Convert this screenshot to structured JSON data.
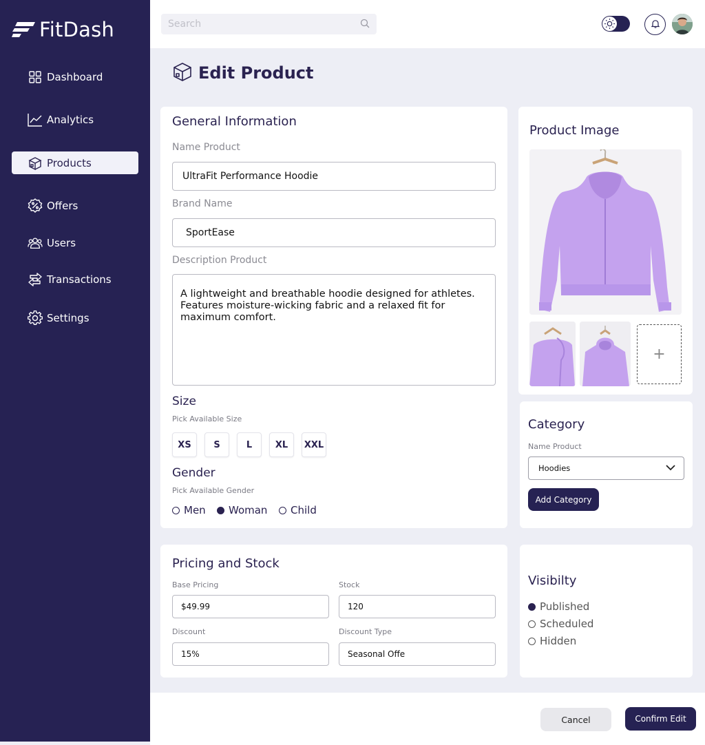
{
  "brand": {
    "name": "FitDash"
  },
  "sidebar": {
    "items": [
      {
        "label": "Dashboard",
        "icon": "grid-icon"
      },
      {
        "label": "Analytics",
        "icon": "chart-icon"
      },
      {
        "label": "Products",
        "icon": "box-icon",
        "active": true
      },
      {
        "label": "Offers",
        "icon": "percent-badge-icon"
      },
      {
        "label": "Users",
        "icon": "users-icon"
      },
      {
        "label": "Transactions",
        "icon": "transfer-icon"
      },
      {
        "label": "Settings",
        "icon": "gear-icon"
      }
    ]
  },
  "topbar": {
    "search_placeholder": "Search"
  },
  "page": {
    "title": "Edit Product"
  },
  "general": {
    "title": "General Information",
    "name_label": "Name Product",
    "name_value": "UltraFit Performance Hoodie",
    "brand_label": "Brand Name",
    "brand_value": "SportEase",
    "desc_label": "Description Product",
    "desc_value": "A lightweight and breathable hoodie designed for athletes. Features moisture-wicking fabric and a relaxed fit for maximum comfort."
  },
  "size": {
    "title": "Size",
    "subtitle": "Pick Available Size",
    "options": [
      "XS",
      "S",
      "L",
      "XL",
      "XXL"
    ]
  },
  "gender": {
    "title": "Gender",
    "subtitle": "Pick Available Gender",
    "options": [
      "Men",
      "Woman",
      "Child"
    ],
    "selected": "Woman"
  },
  "product_image": {
    "title": "Product Image",
    "add_label": "+"
  },
  "category": {
    "title": "Category",
    "label": "Name Product",
    "selected": "Hoodies",
    "add_button": "Add Category"
  },
  "pricing": {
    "title": "Pricing and Stock",
    "base_label": "Base Pricing",
    "base_value": "$49.99",
    "stock_label": "Stock",
    "stock_value": "120",
    "discount_label": "Discount",
    "discount_value": "15%",
    "discount_type_label": "Discount Type",
    "discount_type_value": "Seasonal Offe"
  },
  "visibility": {
    "title": "Visibilty",
    "options": [
      "Published",
      "Scheduled",
      "Hidden"
    ],
    "selected": "Published"
  },
  "footer": {
    "cancel": "Cancel",
    "confirm": "Confirm Edit"
  },
  "colors": {
    "navy": "#262253",
    "lavender": "#c7a8ee",
    "background": "#edeef5"
  }
}
